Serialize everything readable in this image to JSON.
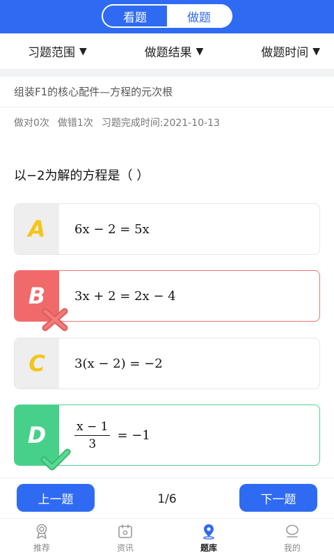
{
  "header": {
    "tabs": [
      {
        "label": "看题",
        "active": false
      },
      {
        "label": "做题",
        "active": true
      }
    ],
    "accent": "#2f6bf2"
  },
  "filters": [
    {
      "label": "习题范围",
      "caret": "▼"
    },
    {
      "label": "做题结果",
      "caret": "▼"
    },
    {
      "label": "做题时间",
      "caret": "▼"
    }
  ],
  "topic": "组装F1的核心配件—方程的元次根",
  "stats": {
    "correct": "做对0次",
    "wrong": "做错1次",
    "completed": "习题完成时间:2021-10-13"
  },
  "question": "以−2为解的方程是（   ）",
  "options": [
    {
      "letter": "A",
      "formula": "6x − 2 = 5x",
      "state": "normal"
    },
    {
      "letter": "B",
      "formula": "3x + 2 = 2x − 4",
      "state": "wrong"
    },
    {
      "letter": "C",
      "formula": "3(x − 2) = −2",
      "state": "normal"
    },
    {
      "letter": "D",
      "frac_num": "x − 1",
      "frac_den": "3",
      "formula_rest": "= −1",
      "state": "correct"
    }
  ],
  "nav": {
    "prev": "上一题",
    "pager": "1/6",
    "next": "下一题"
  },
  "tabbar": [
    {
      "label": "推荐",
      "icon": "medal-icon",
      "active": false
    },
    {
      "label": "资讯",
      "icon": "calendar-icon",
      "active": false
    },
    {
      "label": "题库",
      "icon": "location-pin-icon",
      "active": true
    },
    {
      "label": "我的",
      "icon": "profile-icon",
      "active": false
    }
  ],
  "colors": {
    "wrong": "#f06a6a",
    "correct": "#47d08a",
    "letter_yellow": "#f5c518"
  }
}
